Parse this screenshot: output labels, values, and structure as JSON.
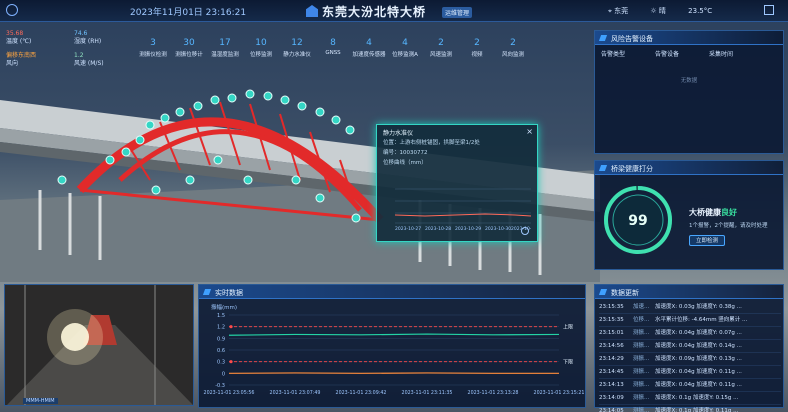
{
  "header": {
    "datetime": "2023年11月01日 23:16:21",
    "title": "东莞大汾北特大桥",
    "tag": "运维管理",
    "location": "东莞",
    "weather": "晴",
    "temperature": "23.5°C"
  },
  "environment": [
    {
      "value": "35.68",
      "label": "温度 (℃)"
    },
    {
      "value": "74.6",
      "label": "湿度 (RH)"
    },
    {
      "value": "偏移东南西",
      "label": "风向"
    },
    {
      "value": "1.2",
      "label": "风速 (M/S)"
    }
  ],
  "stats": [
    {
      "count": "3",
      "label": "测振仪检测"
    },
    {
      "count": "30",
      "label": "测振位移计"
    },
    {
      "count": "17",
      "label": "温湿度监测"
    },
    {
      "count": "10",
      "label": "位移监测"
    },
    {
      "count": "12",
      "label": "静力水准仪"
    },
    {
      "count": "8",
      "label": "GNSS"
    },
    {
      "count": "4",
      "label": "加速度传感器"
    },
    {
      "count": "4",
      "label": "位移监测A"
    },
    {
      "count": "2",
      "label": "风速监测"
    },
    {
      "count": "2",
      "label": "视频"
    },
    {
      "count": "2",
      "label": "风向监测"
    }
  ],
  "popup": {
    "title": "静力水准仪",
    "location": "位置：上游右侧桩锚固，拱脚至梁1/2处",
    "id": "编号：10030772",
    "trend_label": "位移曲线（mm）",
    "dates": [
      "2023-10-27",
      "2023-10-28",
      "2023-10-29",
      "2023-10-30",
      "2023-10-31"
    ]
  },
  "alarm_panel": {
    "title": "风险告警设备",
    "cols": [
      "告警类型",
      "告警设备",
      "采集时间"
    ],
    "empty": "无数据"
  },
  "health_panel": {
    "title": "桥梁健康打分",
    "score": "99",
    "label_a": "大桥健康",
    "label_b": "良好",
    "summary": "1个报警，2个提醒，请及时处理",
    "button": "立即检测"
  },
  "camera": {
    "tag": "MMM-HMIM"
  },
  "realtime_panel": {
    "title": "实时数据",
    "unit": "振幅(mm)",
    "series": [
      {
        "name": "上限"
      },
      {
        "name": "下限"
      }
    ]
  },
  "data_panel": {
    "title": "数据更新",
    "rows": [
      {
        "time": "23:15:35",
        "type": "加速...",
        "text": "加速度X: 0.03g 加速度Y: 0.38g ..."
      },
      {
        "time": "23:15:35",
        "type": "位移...",
        "text": "水平累计位移: -4.64mm 竖向累计 ..."
      },
      {
        "time": "23:15:01",
        "type": "测振...",
        "text": "加速度X: 0.04g 加速度Y: 0.07g ..."
      },
      {
        "time": "23:14:56",
        "type": "测振...",
        "text": "加速度X: 0.04g 加速度Y: 0.14g ..."
      },
      {
        "time": "23:14:29",
        "type": "测振...",
        "text": "加速度X: 0.09g 加速度Y: 0.13g ..."
      },
      {
        "time": "23:14:45",
        "type": "测振...",
        "text": "加速度X: 0.04g 加速度Y: 0.11g ..."
      },
      {
        "time": "23:14:13",
        "type": "测振...",
        "text": "加速度X: 0.04g 加速度Y: 0.11g ..."
      },
      {
        "time": "23:14:09",
        "type": "测振...",
        "text": "加速度X: 0.1g 加速度Y: 0.15g ..."
      },
      {
        "time": "23:14:05",
        "type": "测振...",
        "text": "加速度X: 0.1g 加速度Y: 0.11g ..."
      }
    ]
  },
  "chart_data": {
    "type": "line",
    "title": "",
    "ylabel": "振幅(mm)",
    "ylim": [
      -0.3,
      1.5
    ],
    "yticks": [
      1.5,
      1.2,
      0.9,
      0.6,
      0.3,
      0,
      -0.3
    ],
    "x": [
      "2023-11-01 23:05:56",
      "2023-11-01 23:07:49",
      "2023-11-01 23:09:42",
      "2023-11-01 23:11:35",
      "2023-11-01 23:13:28",
      "2023-11-01 23:15:21"
    ],
    "series": [
      {
        "name": "上限",
        "values": [
          1.2,
          1.2,
          1.2,
          1.2,
          1.2,
          1.2
        ],
        "color": "#ff4a4a"
      },
      {
        "name": "",
        "values": [
          0.98,
          1.0,
          0.99,
          1.01,
          0.99,
          1.0
        ],
        "color": "#23d3a5"
      },
      {
        "name": "下限",
        "values": [
          0.3,
          0.3,
          0.3,
          0.3,
          0.3,
          0.3
        ],
        "color": "#ff4a4a"
      },
      {
        "name": "",
        "values": [
          0.0,
          0.01,
          0.0,
          0.01,
          0.0,
          0.0
        ],
        "color": "#ff8c3a"
      }
    ],
    "grid": true
  },
  "colors": {
    "accent": "#3fa0ff",
    "bridge": "#e22a2a",
    "sensor": "#34d6c5"
  }
}
